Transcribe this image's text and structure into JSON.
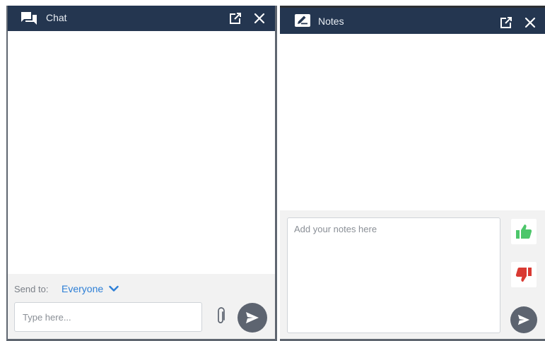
{
  "chat": {
    "title": "Chat",
    "icons": {
      "header": "chat-bubbles-icon",
      "popout": "popout-icon",
      "close": "close-icon",
      "attach": "paperclip-icon",
      "send": "send-icon",
      "dropdown": "chevron-down-icon"
    },
    "send_to_label": "Send to:",
    "recipient": "Everyone",
    "input_placeholder": "Type here...",
    "input_value": ""
  },
  "notes": {
    "title": "Notes",
    "icons": {
      "header": "notes-edit-icon",
      "popout": "popout-icon",
      "close": "close-icon",
      "like": "thumbs-up-icon",
      "dislike": "thumbs-down-icon",
      "send": "send-icon"
    },
    "input_placeholder": "Add your notes here",
    "input_value": ""
  },
  "colors": {
    "header_bg": "#243650",
    "accent_blue": "#2d7fd6",
    "send_button": "#5d6470",
    "thumbs_up": "#4cc66a",
    "thumbs_down": "#d93a33",
    "footer_bg": "#f2f2f2"
  }
}
